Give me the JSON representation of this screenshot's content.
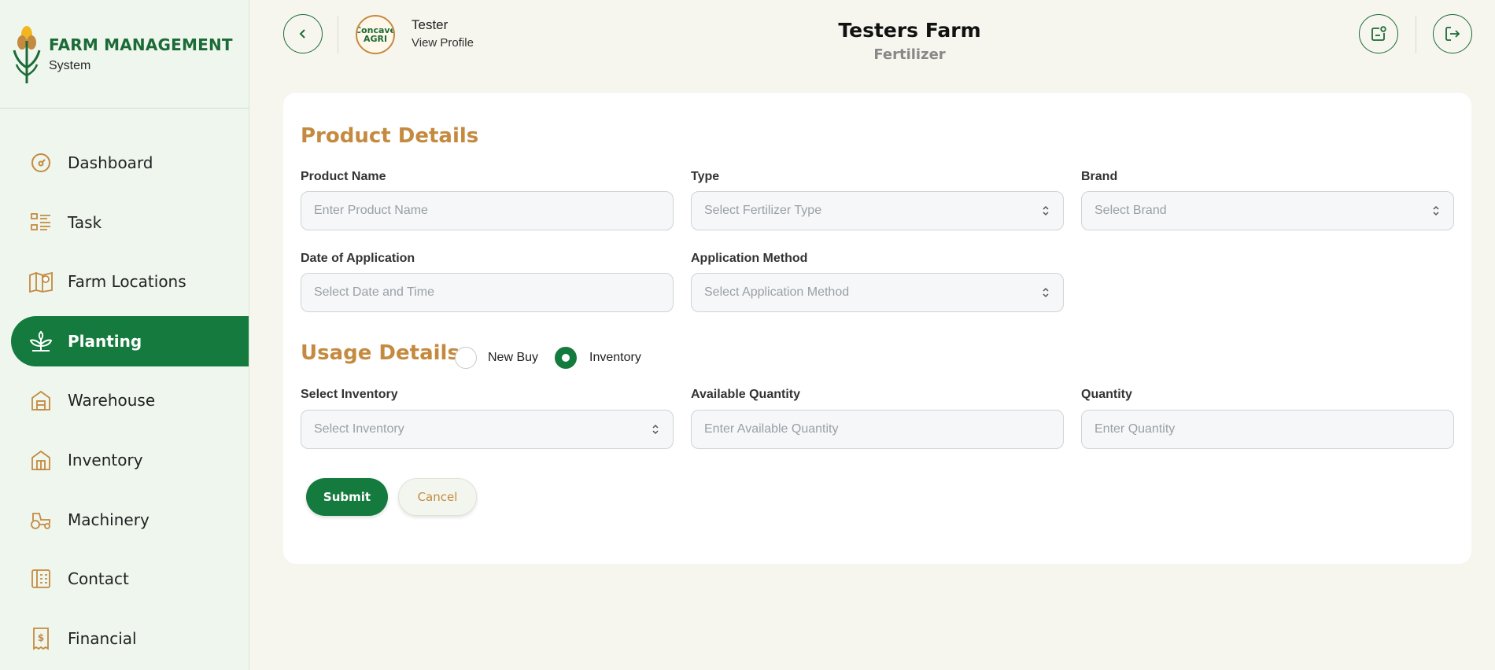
{
  "brand": {
    "title": "FARM MANAGEMENT",
    "subtitle": "System"
  },
  "sidebar": {
    "items": [
      {
        "label": "Dashboard",
        "icon": "dashboard-icon"
      },
      {
        "label": "Task",
        "icon": "task-list-icon"
      },
      {
        "label": "Farm Locations",
        "icon": "map-pin-icon"
      },
      {
        "label": "Planting",
        "icon": "plant-icon",
        "active": true
      },
      {
        "label": "Warehouse",
        "icon": "warehouse-icon"
      },
      {
        "label": "Inventory",
        "icon": "inventory-icon"
      },
      {
        "label": "Machinery",
        "icon": "tractor-icon"
      },
      {
        "label": "Contact",
        "icon": "contact-icon"
      },
      {
        "label": "Financial",
        "icon": "receipt-icon"
      }
    ]
  },
  "header": {
    "user_name": "Tester",
    "view_profile": "View Profile",
    "avatar_text": "Concave AGRI",
    "farm_title": "Testers Farm",
    "farm_subtitle": "Fertilizer"
  },
  "form": {
    "product_section_title": "Product Details",
    "product_name": {
      "label": "Product Name",
      "placeholder": "Enter Product Name"
    },
    "type": {
      "label": "Type",
      "placeholder": "Select Fertilizer Type"
    },
    "brand": {
      "label": "Brand",
      "placeholder": "Select Brand"
    },
    "date_of_application": {
      "label": "Date of Application",
      "placeholder": "Select Date and Time"
    },
    "application_method": {
      "label": "Application Method",
      "placeholder": "Select Application Method"
    },
    "usage_section_title": "Usage Details",
    "usage_options": {
      "new_buy": "New Buy",
      "inventory": "Inventory",
      "selected": "Inventory"
    },
    "select_inventory": {
      "label": "Select Inventory",
      "placeholder": "Select Inventory"
    },
    "available_quantity": {
      "label": "Available Quantity",
      "placeholder": "Enter Available Quantity"
    },
    "quantity": {
      "label": "Quantity",
      "placeholder": "Enter Quantity"
    },
    "submit_label": "Submit",
    "cancel_label": "Cancel"
  },
  "colors": {
    "primary_green": "#157a3d",
    "accent_gold": "#c48a3f",
    "sidebar_bg": "#eef6ee",
    "page_bg": "#f6f6ef"
  }
}
